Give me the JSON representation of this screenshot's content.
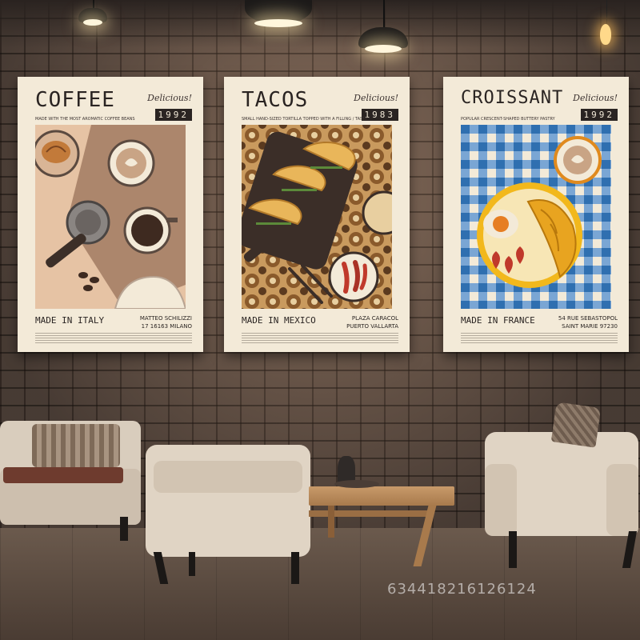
{
  "posters": [
    {
      "title": "COFFEE",
      "badge": "Delicious!",
      "year": "1992",
      "tagline": "MADE WITH THE MOST AROMATIC COFFEE BEANS",
      "made_in": "MADE IN ITALY",
      "address_line1": "MATTEO SCHILIZZI",
      "address_line2": "17 16163 MILANO"
    },
    {
      "title": "TACOS",
      "badge": "Delicious!",
      "year": "1983",
      "tagline": "SMALL HAND-SIZED TORTILLA TOPPED WITH A FILLING / TASTY",
      "made_in": "MADE IN MEXICO",
      "address_line1": "PLAZA CARACOL",
      "address_line2": "PUERTO VALLARTA"
    },
    {
      "title": "CROISSANT",
      "badge": "Delicious!",
      "year": "1992",
      "tagline": "POPULAR CRESCENT-SHAPED BUTTERY PASTRY",
      "made_in": "MADE IN FRANCE",
      "address_line1": "54 RUE SEBASTOPOL",
      "address_line2": "SAINT MARIE 97230"
    }
  ],
  "watermark": "634418216126124",
  "colors": {
    "poster_bg": "#f3ead8",
    "ink": "#2a2422",
    "coffee_bg": "#e6c3a4",
    "tacos_pattern": "#a5743f",
    "croissant_blue": "#2f6fb0",
    "croissant_yellow": "#f2b81c"
  }
}
